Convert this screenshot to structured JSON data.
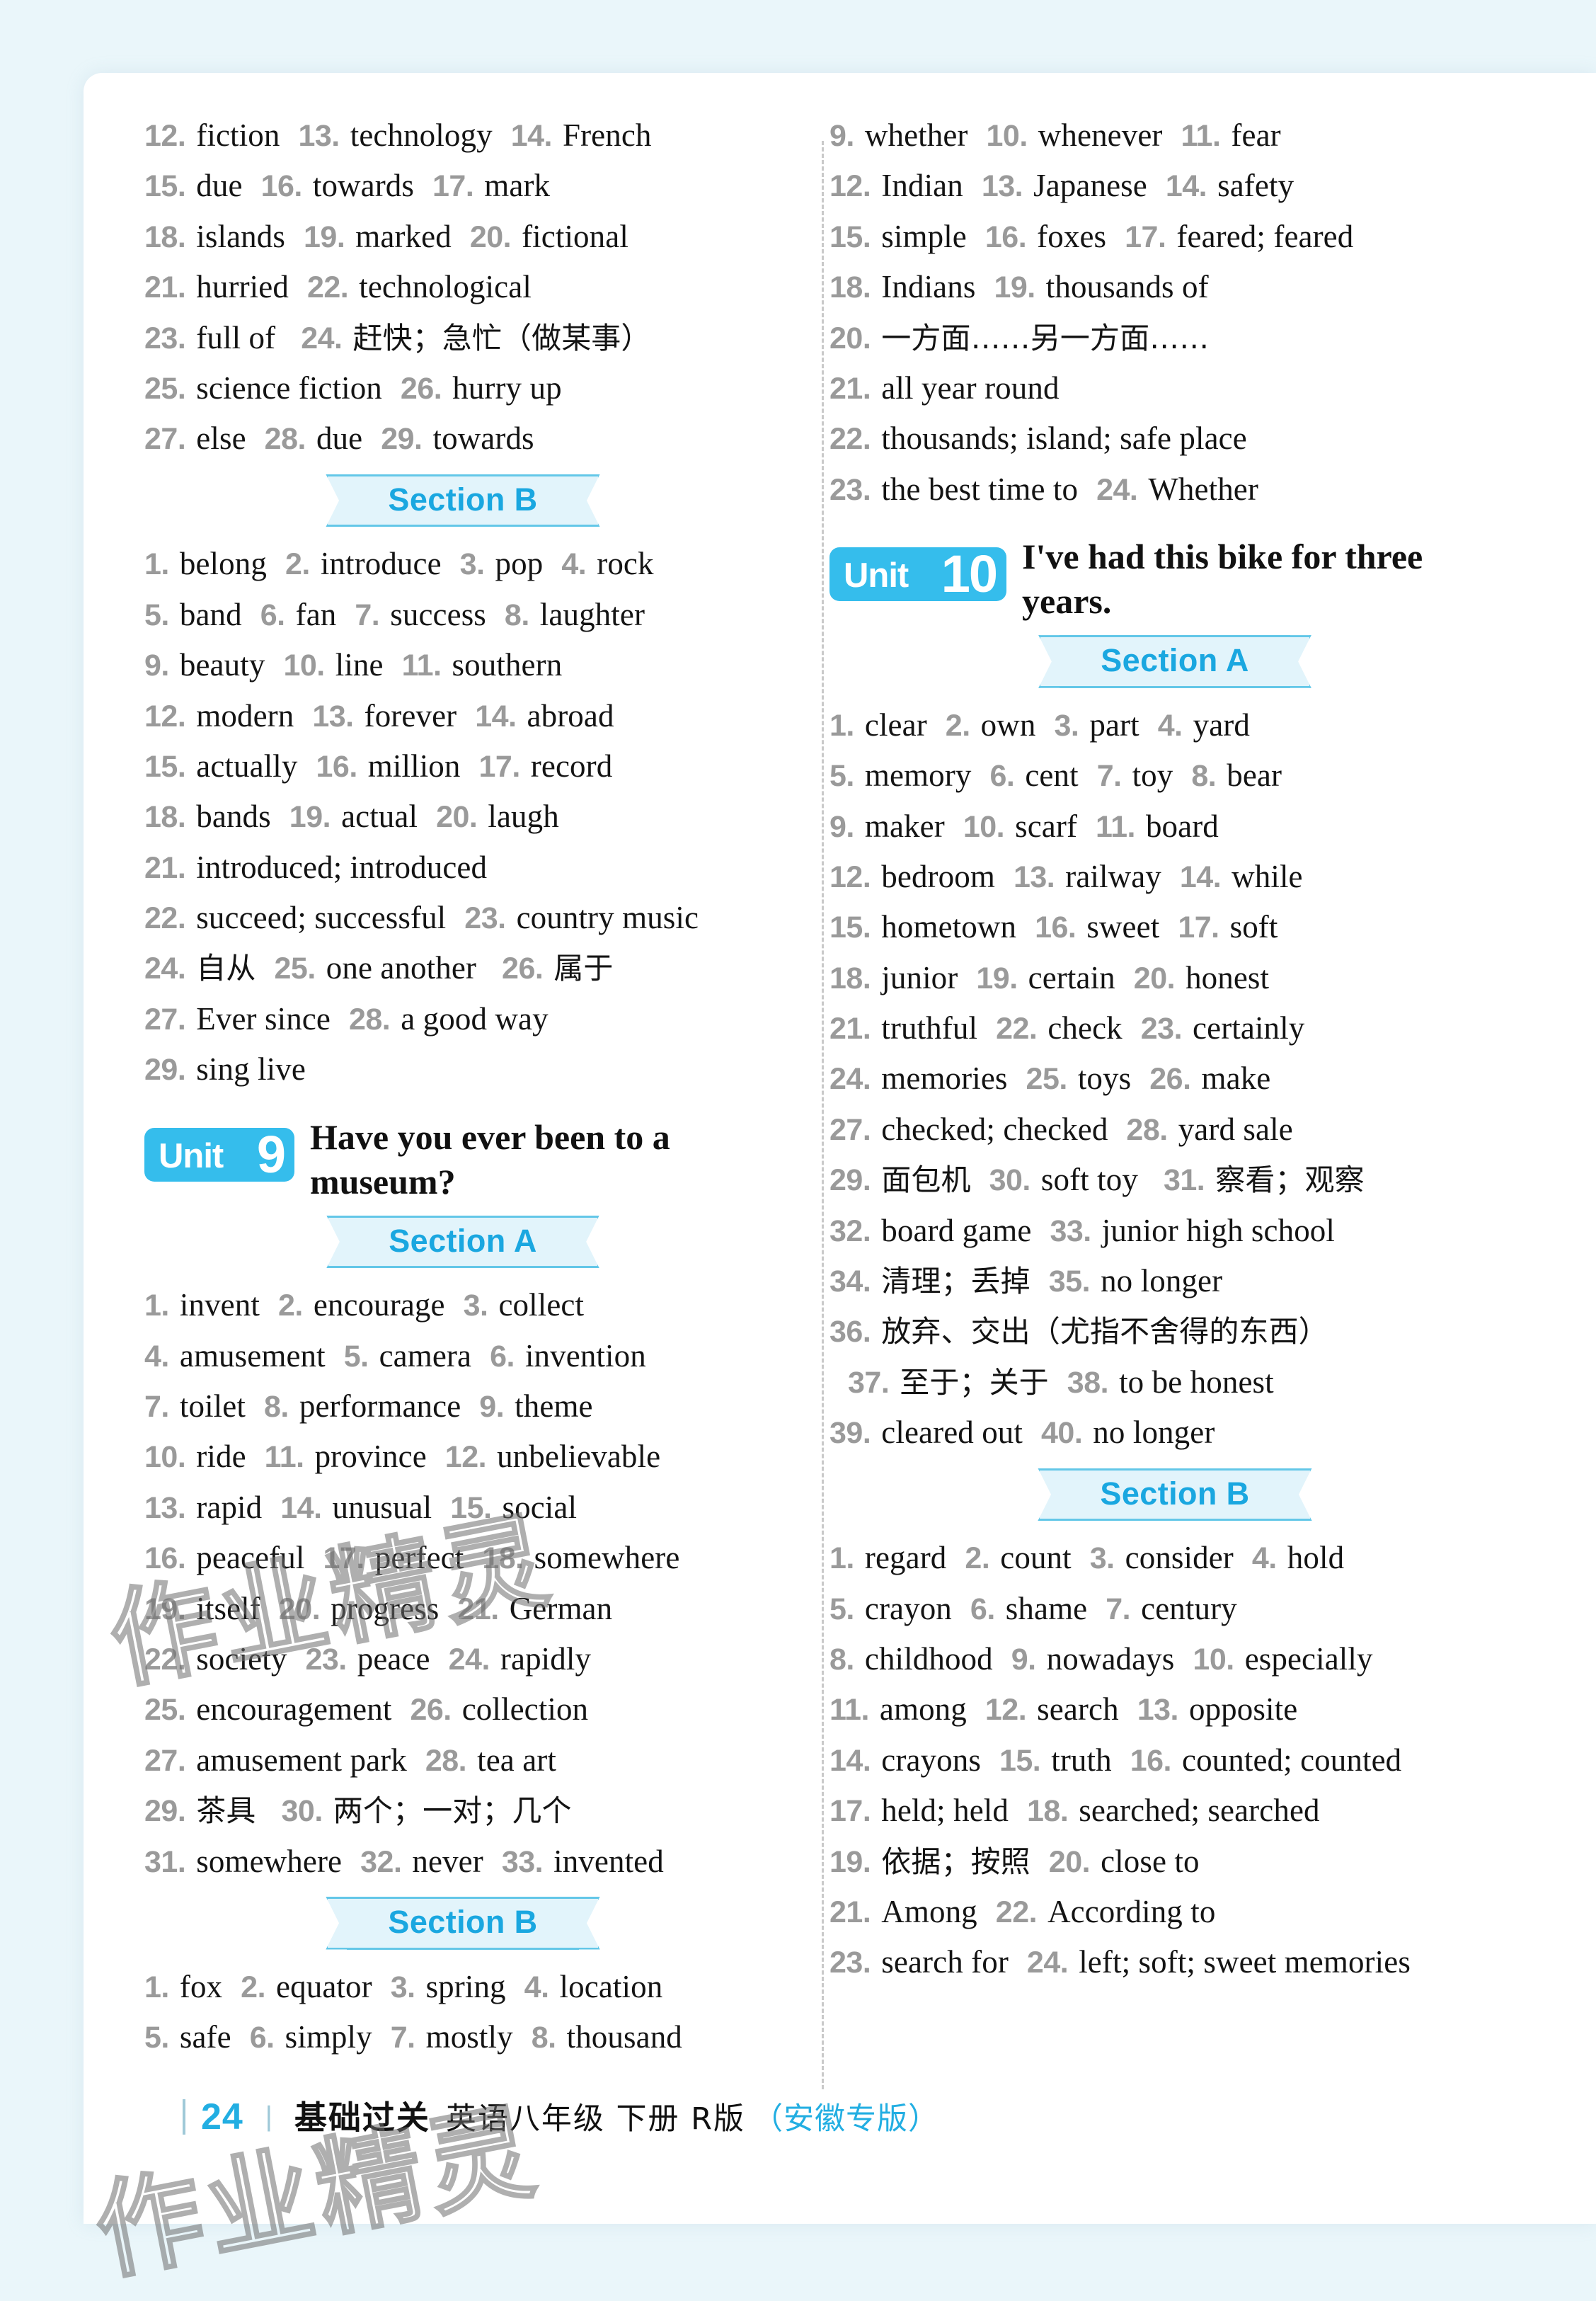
{
  "page": {
    "background_color": "#eaf6fa",
    "sheet_color": "#ffffff",
    "accent_color": "#22aee2",
    "badge_color": "#35bdec",
    "ribbon_fill": "#e2f4fb",
    "ribbon_border": "#63c7e8",
    "number_color": "#9a9a9a"
  },
  "watermark": {
    "text": "作业精灵"
  },
  "footer": {
    "page_number": "24",
    "separator": "丨",
    "series_title": "基础过关",
    "subject": "英语八年级 下册 R版",
    "edition": "（安徽专版）"
  },
  "left_column": {
    "continued_list": {
      "lines": [
        [
          {
            "num": "12.",
            "txt": "fiction"
          },
          {
            "num": "13.",
            "txt": "technology"
          },
          {
            "num": "14.",
            "txt": "French"
          }
        ],
        [
          {
            "num": "15.",
            "txt": "due"
          },
          {
            "num": "16.",
            "txt": "towards"
          },
          {
            "num": "17.",
            "txt": "mark"
          }
        ],
        [
          {
            "num": "18.",
            "txt": "islands"
          },
          {
            "num": "19.",
            "txt": "marked"
          },
          {
            "num": "20.",
            "txt": "fictional"
          }
        ],
        [
          {
            "num": "21.",
            "txt": "hurried"
          },
          {
            "num": "22.",
            "txt": "technological"
          }
        ],
        [
          {
            "num": "23.",
            "txt": "full of"
          },
          {
            "num": "24.",
            "txt": "赶快；急忙（做某事）",
            "cn": true
          }
        ],
        [
          {
            "num": "25.",
            "txt": "science fiction"
          },
          {
            "num": "26.",
            "txt": "hurry up"
          }
        ],
        [
          {
            "num": "27.",
            "txt": "else"
          },
          {
            "num": "28.",
            "txt": "due"
          },
          {
            "num": "29.",
            "txt": "towards"
          }
        ]
      ]
    },
    "section_b_1": {
      "label": "Section B",
      "lines": [
        [
          {
            "num": "1.",
            "txt": "belong"
          },
          {
            "num": "2.",
            "txt": "introduce"
          },
          {
            "num": "3.",
            "txt": "pop"
          },
          {
            "num": "4.",
            "txt": "rock"
          }
        ],
        [
          {
            "num": "5.",
            "txt": "band"
          },
          {
            "num": "6.",
            "txt": "fan"
          },
          {
            "num": "7.",
            "txt": "success"
          },
          {
            "num": "8.",
            "txt": "laughter"
          }
        ],
        [
          {
            "num": "9.",
            "txt": "beauty"
          },
          {
            "num": "10.",
            "txt": "line"
          },
          {
            "num": "11.",
            "txt": "southern"
          }
        ],
        [
          {
            "num": "12.",
            "txt": "modern"
          },
          {
            "num": "13.",
            "txt": "forever"
          },
          {
            "num": "14.",
            "txt": "abroad"
          }
        ],
        [
          {
            "num": "15.",
            "txt": "actually"
          },
          {
            "num": "16.",
            "txt": "million"
          },
          {
            "num": "17.",
            "txt": "record"
          }
        ],
        [
          {
            "num": "18.",
            "txt": "bands"
          },
          {
            "num": "19.",
            "txt": "actual"
          },
          {
            "num": "20.",
            "txt": "laugh"
          }
        ],
        [
          {
            "num": "21.",
            "txt": "introduced; introduced"
          }
        ],
        [
          {
            "num": "22.",
            "txt": "succeed; successful"
          },
          {
            "num": "23.",
            "txt": "country music"
          }
        ],
        [
          {
            "num": "24.",
            "txt": "自从",
            "cn": true
          },
          {
            "num": "25.",
            "txt": "one another"
          },
          {
            "num": "26.",
            "txt": "属于",
            "cn": true
          }
        ],
        [
          {
            "num": "27.",
            "txt": "Ever since"
          },
          {
            "num": "28.",
            "txt": "a good way"
          }
        ],
        [
          {
            "num": "29.",
            "txt": "sing live"
          }
        ]
      ]
    },
    "unit9": {
      "unit_word": "Unit",
      "unit_number": "9",
      "title": "Have you ever been to a museum?"
    },
    "unit9_section_a": {
      "label": "Section A",
      "lines": [
        [
          {
            "num": "1.",
            "txt": "invent"
          },
          {
            "num": "2.",
            "txt": "encourage"
          },
          {
            "num": "3.",
            "txt": "collect"
          }
        ],
        [
          {
            "num": "4.",
            "txt": "amusement"
          },
          {
            "num": "5.",
            "txt": "camera"
          },
          {
            "num": "6.",
            "txt": "invention"
          }
        ],
        [
          {
            "num": "7.",
            "txt": "toilet"
          },
          {
            "num": "8.",
            "txt": "performance"
          },
          {
            "num": "9.",
            "txt": "theme"
          }
        ],
        [
          {
            "num": "10.",
            "txt": "ride"
          },
          {
            "num": "11.",
            "txt": "province"
          },
          {
            "num": "12.",
            "txt": "unbelievable"
          }
        ],
        [
          {
            "num": "13.",
            "txt": "rapid"
          },
          {
            "num": "14.",
            "txt": "unusual"
          },
          {
            "num": "15.",
            "txt": "social"
          }
        ],
        [
          {
            "num": "16.",
            "txt": "peaceful"
          },
          {
            "num": "17.",
            "txt": "perfect"
          },
          {
            "num": "18.",
            "txt": "somewhere"
          }
        ],
        [
          {
            "num": "19.",
            "txt": "itself"
          },
          {
            "num": "20.",
            "txt": "progress"
          },
          {
            "num": "21.",
            "txt": "German"
          }
        ],
        [
          {
            "num": "22.",
            "txt": "society"
          },
          {
            "num": "23.",
            "txt": "peace"
          },
          {
            "num": "24.",
            "txt": "rapidly"
          }
        ],
        [
          {
            "num": "25.",
            "txt": "encouragement"
          },
          {
            "num": "26.",
            "txt": "collection"
          }
        ],
        [
          {
            "num": "27.",
            "txt": "amusement park"
          },
          {
            "num": "28.",
            "txt": "tea art"
          }
        ],
        [
          {
            "num": "29.",
            "txt": "茶具",
            "cn": true
          },
          {
            "num": "30.",
            "txt": "两个；一对；几个",
            "cn": true
          }
        ],
        [
          {
            "num": "31.",
            "txt": "somewhere"
          },
          {
            "num": "32.",
            "txt": "never"
          },
          {
            "num": "33.",
            "txt": "invented"
          }
        ]
      ]
    },
    "unit9_section_b": {
      "label": "Section B",
      "lines": [
        [
          {
            "num": "1.",
            "txt": "fox"
          },
          {
            "num": "2.",
            "txt": "equator"
          },
          {
            "num": "3.",
            "txt": "spring"
          },
          {
            "num": "4.",
            "txt": "location"
          }
        ],
        [
          {
            "num": "5.",
            "txt": "safe"
          },
          {
            "num": "6.",
            "txt": "simply"
          },
          {
            "num": "7.",
            "txt": "mostly"
          },
          {
            "num": "8.",
            "txt": "thousand"
          }
        ]
      ]
    }
  },
  "right_column": {
    "continued_list": {
      "lines": [
        [
          {
            "num": "9.",
            "txt": "whether"
          },
          {
            "num": "10.",
            "txt": "whenever"
          },
          {
            "num": "11.",
            "txt": "fear"
          }
        ],
        [
          {
            "num": "12.",
            "txt": "Indian"
          },
          {
            "num": "13.",
            "txt": "Japanese"
          },
          {
            "num": "14.",
            "txt": "safety"
          }
        ],
        [
          {
            "num": "15.",
            "txt": "simple"
          },
          {
            "num": "16.",
            "txt": "foxes"
          },
          {
            "num": "17.",
            "txt": "feared; feared"
          }
        ],
        [
          {
            "num": "18.",
            "txt": "Indians"
          },
          {
            "num": "19.",
            "txt": "thousands of"
          }
        ],
        [
          {
            "num": "20.",
            "txt": "一方面……另一方面……",
            "cn": true
          }
        ],
        [
          {
            "num": "21.",
            "txt": "all year round"
          }
        ],
        [
          {
            "num": "22.",
            "txt": "thousands; island; safe place"
          }
        ],
        [
          {
            "num": "23.",
            "txt": "the best time to"
          },
          {
            "num": "24.",
            "txt": "Whether"
          }
        ]
      ]
    },
    "unit10": {
      "unit_word": "Unit",
      "unit_number": "10",
      "title": "I've had this bike for three years."
    },
    "unit10_section_a": {
      "label": "Section A",
      "lines": [
        [
          {
            "num": "1.",
            "txt": "clear"
          },
          {
            "num": "2.",
            "txt": "own"
          },
          {
            "num": "3.",
            "txt": "part"
          },
          {
            "num": "4.",
            "txt": "yard"
          }
        ],
        [
          {
            "num": "5.",
            "txt": "memory"
          },
          {
            "num": "6.",
            "txt": "cent"
          },
          {
            "num": "7.",
            "txt": "toy"
          },
          {
            "num": "8.",
            "txt": "bear"
          }
        ],
        [
          {
            "num": "9.",
            "txt": "maker"
          },
          {
            "num": "10.",
            "txt": "scarf"
          },
          {
            "num": "11.",
            "txt": "board"
          }
        ],
        [
          {
            "num": "12.",
            "txt": "bedroom"
          },
          {
            "num": "13.",
            "txt": "railway"
          },
          {
            "num": "14.",
            "txt": "while"
          }
        ],
        [
          {
            "num": "15.",
            "txt": "hometown"
          },
          {
            "num": "16.",
            "txt": "sweet"
          },
          {
            "num": "17.",
            "txt": "soft"
          }
        ],
        [
          {
            "num": "18.",
            "txt": "junior"
          },
          {
            "num": "19.",
            "txt": "certain"
          },
          {
            "num": "20.",
            "txt": "honest"
          }
        ],
        [
          {
            "num": "21.",
            "txt": "truthful"
          },
          {
            "num": "22.",
            "txt": "check"
          },
          {
            "num": "23.",
            "txt": "certainly"
          }
        ],
        [
          {
            "num": "24.",
            "txt": "memories"
          },
          {
            "num": "25.",
            "txt": "toys"
          },
          {
            "num": "26.",
            "txt": "make"
          }
        ],
        [
          {
            "num": "27.",
            "txt": "checked; checked"
          },
          {
            "num": "28.",
            "txt": "yard sale"
          }
        ],
        [
          {
            "num": "29.",
            "txt": "面包机",
            "cn": true
          },
          {
            "num": "30.",
            "txt": "soft toy"
          },
          {
            "num": "31.",
            "txt": "察看；观察",
            "cn": true
          }
        ],
        [
          {
            "num": "32.",
            "txt": "board game"
          },
          {
            "num": "33.",
            "txt": "junior high school"
          }
        ],
        [
          {
            "num": "34.",
            "txt": "清理；丢掉",
            "cn": true
          },
          {
            "num": "35.",
            "txt": "no longer"
          }
        ],
        [
          {
            "num": "36.",
            "txt": "放弃、交出（尤指不舍得的东西）",
            "cn": true
          }
        ],
        [
          {
            "num": "37.",
            "txt": "至于；关于",
            "cn": true,
            "indent": true
          },
          {
            "num": "38.",
            "txt": "to be honest"
          }
        ],
        [
          {
            "num": "39.",
            "txt": "cleared out"
          },
          {
            "num": "40.",
            "txt": "no longer"
          }
        ]
      ]
    },
    "unit10_section_b": {
      "label": "Section B",
      "lines": [
        [
          {
            "num": "1.",
            "txt": "regard"
          },
          {
            "num": "2.",
            "txt": "count"
          },
          {
            "num": "3.",
            "txt": "consider"
          },
          {
            "num": "4.",
            "txt": "hold"
          }
        ],
        [
          {
            "num": "5.",
            "txt": "crayon"
          },
          {
            "num": "6.",
            "txt": "shame"
          },
          {
            "num": "7.",
            "txt": "century"
          }
        ],
        [
          {
            "num": "8.",
            "txt": "childhood"
          },
          {
            "num": "9.",
            "txt": "nowadays"
          },
          {
            "num": "10.",
            "txt": "especially"
          }
        ],
        [
          {
            "num": "11.",
            "txt": "among"
          },
          {
            "num": "12.",
            "txt": "search"
          },
          {
            "num": "13.",
            "txt": "opposite"
          }
        ],
        [
          {
            "num": "14.",
            "txt": "crayons"
          },
          {
            "num": "15.",
            "txt": "truth"
          },
          {
            "num": "16.",
            "txt": "counted; counted"
          }
        ],
        [
          {
            "num": "17.",
            "txt": "held; held"
          },
          {
            "num": "18.",
            "txt": "searched; searched"
          }
        ],
        [
          {
            "num": "19.",
            "txt": "依据；按照",
            "cn": true
          },
          {
            "num": "20.",
            "txt": "close to"
          }
        ],
        [
          {
            "num": "21.",
            "txt": "Among"
          },
          {
            "num": "22.",
            "txt": "According to"
          }
        ],
        [
          {
            "num": "23.",
            "txt": "search for"
          },
          {
            "num": "24.",
            "txt": "left; soft; sweet memories"
          }
        ]
      ]
    }
  }
}
